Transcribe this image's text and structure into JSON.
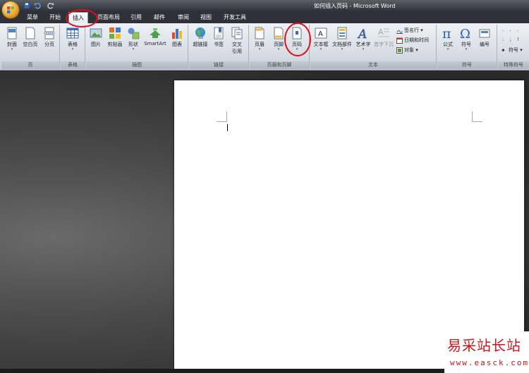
{
  "window": {
    "title_doc": "如何插入页码",
    "title_sep": " - ",
    "title_app": "Microsoft Word"
  },
  "quick_access": [
    "save-icon",
    "undo-icon",
    "redo-icon"
  ],
  "tabs": [
    {
      "label": "菜单"
    },
    {
      "label": "开始"
    },
    {
      "label": "插入",
      "active": true
    },
    {
      "label": "页面布局"
    },
    {
      "label": "引用"
    },
    {
      "label": "邮件"
    },
    {
      "label": "审阅"
    },
    {
      "label": "视图"
    },
    {
      "label": "开发工具"
    }
  ],
  "ribbon": {
    "pages": {
      "label": "页",
      "buttons": [
        "封面",
        "空白页",
        "分页"
      ]
    },
    "tables": {
      "label": "表格",
      "buttons": [
        "表格"
      ]
    },
    "illustrations": {
      "label": "插图",
      "buttons": [
        "图片",
        "剪贴画",
        "形状",
        "SmartArt",
        "图表"
      ]
    },
    "links": {
      "label": "链接",
      "buttons": [
        "超链接",
        "书签",
        "交叉",
        "引用"
      ]
    },
    "header_footer": {
      "label": "页眉和页脚",
      "buttons": [
        "页眉",
        "页脚",
        "页码"
      ]
    },
    "text": {
      "label": "文本",
      "buttons": [
        "文本框",
        "文档部件",
        "艺术字",
        "首字下沉"
      ],
      "small": [
        "签名行",
        "日期和时间",
        "对象"
      ]
    },
    "symbols": {
      "label": "符号",
      "buttons": [
        "公式",
        "符号",
        "编号"
      ]
    },
    "special": {
      "label": "特殊符号",
      "small": [
        "符号"
      ]
    }
  },
  "watermark": {
    "cn": "易采站长站",
    "en": "www.easck.com"
  },
  "colors": {
    "accent_red": "#e0101a",
    "watermark_red": "#c7161e"
  }
}
